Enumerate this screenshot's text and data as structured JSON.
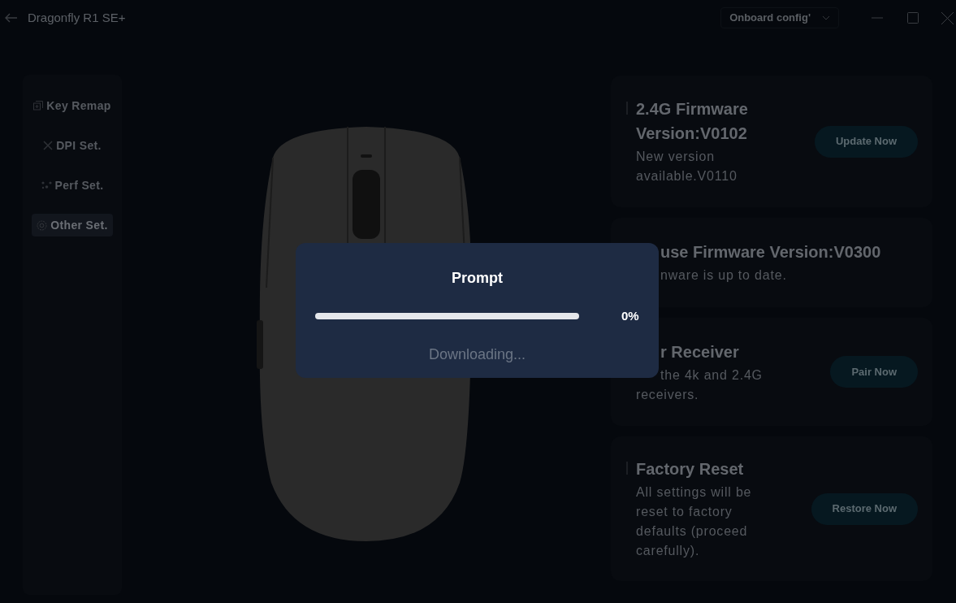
{
  "window": {
    "title": "Dragonfly R1 SE+"
  },
  "config_dropdown": {
    "value": "Onboard config'"
  },
  "sidebar": {
    "items": [
      {
        "label": "Key Remap",
        "selected": false
      },
      {
        "label": "DPI Set.",
        "selected": false
      },
      {
        "label": "Perf Set.",
        "selected": false
      },
      {
        "label": "Other Set.",
        "selected": true
      }
    ]
  },
  "cards": [
    {
      "title_lines": [
        {
          "text": "2.4G Firmware"
        },
        {
          "text": "Version:V0102"
        }
      ],
      "description_lines": [
        {
          "text": "New version"
        },
        {
          "text": "available.V0110"
        }
      ],
      "button": "Update Now"
    },
    {
      "title_lines": [
        {
          "text": "use Firmware Version:V0300"
        }
      ],
      "description_lines": [
        {
          "text": "nware is up to date."
        }
      ]
    },
    {
      "title_lines": [
        {
          "text": "r Receiver"
        }
      ],
      "description_lines": [
        {
          "text": "the 4k and 2.4G"
        },
        {
          "text": "receivers."
        }
      ],
      "button": "Pair Now"
    },
    {
      "title_lines": [
        {
          "text": "Factory Reset"
        }
      ],
      "description_lines": [
        {
          "text": "All settings will be"
        },
        {
          "text": "reset to factory"
        },
        {
          "text": "defaults (proceed"
        },
        {
          "text": "carefully)."
        }
      ],
      "button": "Restore Now"
    }
  ],
  "dialog": {
    "title": "Prompt",
    "progress": {
      "level": 0,
      "reading": "0%"
    },
    "message": "Downloading..."
  }
}
